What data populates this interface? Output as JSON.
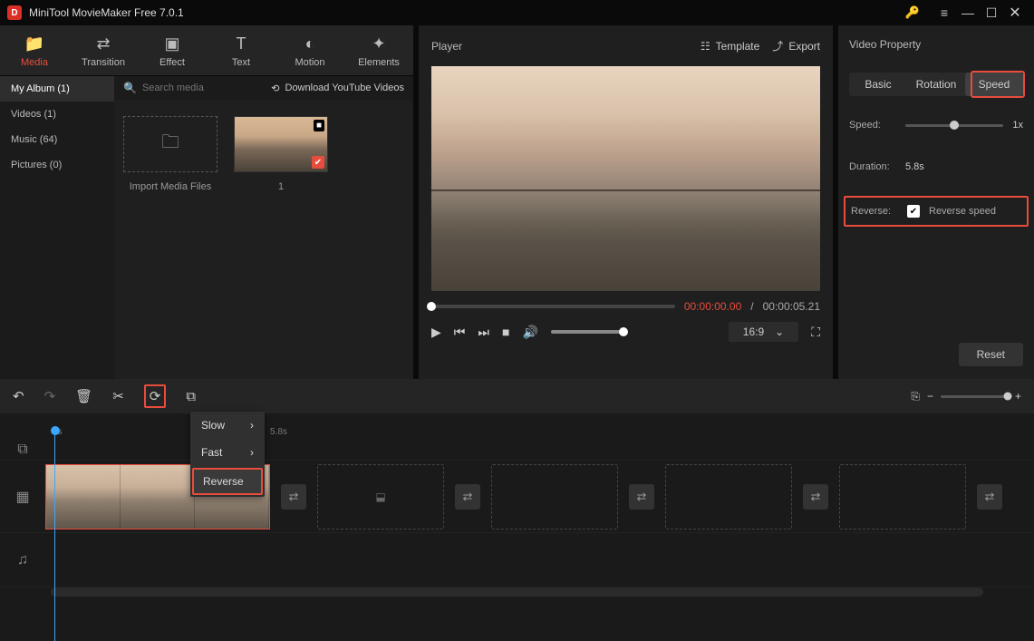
{
  "titlebar": {
    "title": "MiniTool MovieMaker Free 7.0.1"
  },
  "tool_tabs": [
    {
      "label": "Media",
      "icon": "folder"
    },
    {
      "label": "Transition",
      "icon": "swap"
    },
    {
      "label": "Effect",
      "icon": "layers"
    },
    {
      "label": "Text",
      "icon": "text"
    },
    {
      "label": "Motion",
      "icon": "motion"
    },
    {
      "label": "Elements",
      "icon": "sparkle"
    }
  ],
  "sidebar": {
    "items": [
      {
        "label": "My Album (1)"
      },
      {
        "label": "Videos (1)"
      },
      {
        "label": "Music (64)"
      },
      {
        "label": "Pictures (0)"
      }
    ]
  },
  "media_bar": {
    "search_placeholder": "Search media",
    "download_label": "Download YouTube Videos"
  },
  "media_grid": {
    "import_label": "Import Media Files",
    "clip_label": "1"
  },
  "player": {
    "title": "Player",
    "template_label": "Template",
    "export_label": "Export",
    "time_current": "00:00:00.00",
    "time_separator": "/",
    "time_duration": "00:00:05.21",
    "ratio": "16:9"
  },
  "property": {
    "title": "Video Property",
    "tabs": [
      "Basic",
      "Rotation",
      "Speed"
    ],
    "speed_label": "Speed:",
    "speed_value": "1x",
    "duration_label": "Duration:",
    "duration_value": "5.8s",
    "reverse_label": "Reverse:",
    "reverse_text": "Reverse speed",
    "reset_label": "Reset"
  },
  "timeline": {
    "ruler": {
      "t0": "0s",
      "t1": "5.8s"
    },
    "speed_menu": [
      "Slow",
      "Fast",
      "Reverse"
    ]
  }
}
